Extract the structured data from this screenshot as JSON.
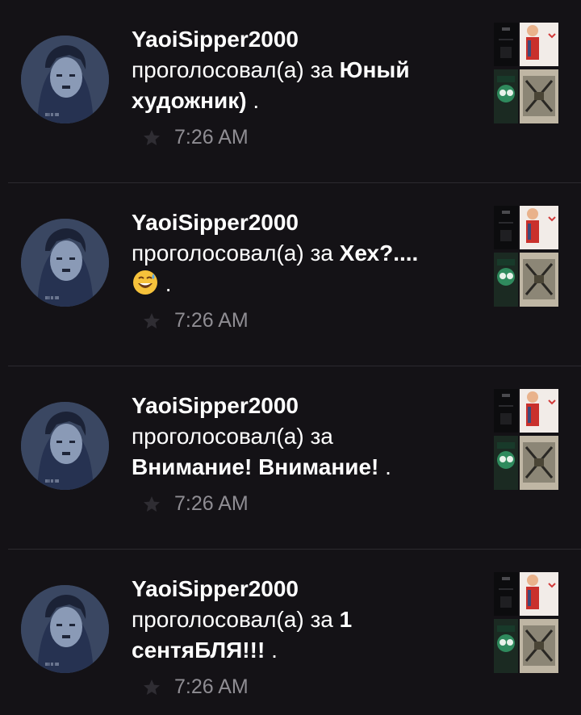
{
  "feed": {
    "items": [
      {
        "username": "YaoiSipper2000",
        "action": "проголосовал(а) за",
        "story_title": "Юный художник)",
        "tail": ".",
        "time": "7:26 AM",
        "has_emoji": false
      },
      {
        "username": "YaoiSipper2000",
        "action": "проголосовал(а) за",
        "story_title": "Хех?....",
        "tail": ".",
        "time": "7:26 AM",
        "has_emoji": true
      },
      {
        "username": "YaoiSipper2000",
        "action": "проголосовал(а) за",
        "story_title": "Внимание! Внимание!",
        "tail": ".",
        "time": "7:26 AM",
        "has_emoji": false
      },
      {
        "username": "YaoiSipper2000",
        "action": "проголосовал(а) за",
        "story_title": "1 сентяБЛЯ!!!",
        "tail": ".",
        "time": "7:26 AM",
        "has_emoji": false
      }
    ]
  },
  "colors": {
    "background": "#141216",
    "text": "#ffffff",
    "meta": "#8f8d93",
    "divider": "#2c2a2f"
  },
  "icons": {
    "vote": "star-icon",
    "emoji": "grinning-sweat-emoji"
  }
}
